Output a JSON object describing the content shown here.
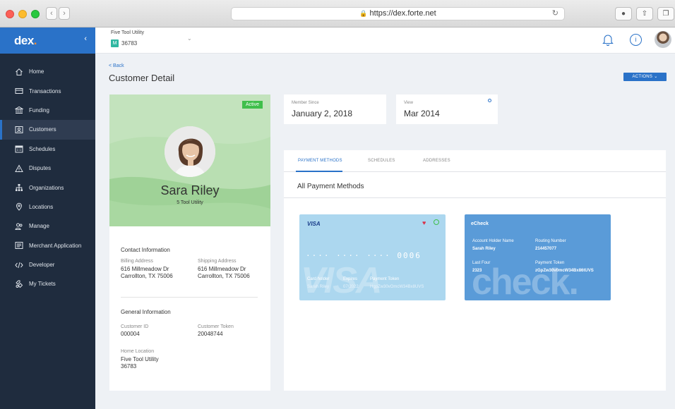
{
  "browser": {
    "url": "https://dex.forte.net"
  },
  "sidebar": {
    "logo": "dex",
    "logo_accent": ".",
    "items": [
      {
        "label": "Home",
        "icon": "home-icon"
      },
      {
        "label": "Transactions",
        "icon": "transactions-icon"
      },
      {
        "label": "Funding",
        "icon": "bank-icon"
      },
      {
        "label": "Customers",
        "icon": "customers-icon",
        "active": true
      },
      {
        "label": "Schedules",
        "icon": "calendar-icon"
      },
      {
        "label": "Disputes",
        "icon": "warning-icon"
      },
      {
        "label": "Organizations",
        "icon": "org-chart-icon"
      },
      {
        "label": "Locations",
        "icon": "location-pin-icon"
      },
      {
        "label": "Manage",
        "icon": "users-icon"
      },
      {
        "label": "Merchant Application",
        "icon": "application-icon"
      },
      {
        "label": "Developer",
        "icon": "code-icon"
      },
      {
        "label": "My Tickets",
        "icon": "ticket-icon"
      }
    ]
  },
  "header": {
    "merchant_name": "Five Tool Utility",
    "merchant_badge": "M",
    "merchant_id": "36783"
  },
  "page": {
    "back": "< Back",
    "title": "Customer Detail",
    "actions": "ACTIONS"
  },
  "customer": {
    "status": "Active",
    "name": "Sara Riley",
    "org": "5 Tool Utility",
    "contact_title": "Contact Information",
    "billing_label": "Billing Address",
    "billing_line1": "616 Millmeadow Dr",
    "billing_line2": "Carrollton, TX 75006",
    "shipping_label": "Shipping Address",
    "shipping_line1": "616 Millmeadow Dr",
    "shipping_line2": "Carrollton, TX 75006",
    "general_title": "General Information",
    "id_label": "Customer ID",
    "id_value": "000004",
    "token_label": "Customer Token",
    "token_value": "20048744",
    "home_label": "Home Location",
    "home_line1": "Five Tool Utility",
    "home_line2": "36783"
  },
  "summary": {
    "member_since_label": "Member Since",
    "member_since_value": "January 2, 2018",
    "view_label": "View",
    "view_value": "Mar 2014"
  },
  "tabs": [
    {
      "label": "PAYMENT METHODS",
      "active": true
    },
    {
      "label": "SCHEDULES"
    },
    {
      "label": "ADDRESSES"
    }
  ],
  "payment_methods": {
    "heading": "All Payment Methods",
    "visa": {
      "brand": "VISA",
      "watermark": "VISA",
      "number": "···· ···· ···· 0006",
      "holder_label": "Card holder",
      "holder_value": "Sarah Riley",
      "expires_label": "Expires",
      "expires_value": "07/2022",
      "token_label": "Payment Token",
      "token_value": "HgpZw30vOmcW34Bx8UVS"
    },
    "echeck": {
      "brand": "eCheck",
      "watermark": "check.",
      "holder_label": "Account Holder Name",
      "holder_value": "Sarah Riley",
      "routing_label": "Routing Number",
      "routing_value": "214457077",
      "last_four_label": "Last Four",
      "last_four_value": "2323",
      "token_label": "Payment Token",
      "token_value": "zGpZw30v0mcW34Bx86tUVS"
    }
  },
  "colors": {
    "accent": "#2a72c8",
    "sidebar": "#1f2c3e",
    "active_badge": "#3fbf4b",
    "hero_green": "#b9dfb2",
    "visa_card": "#acd7ef",
    "echeck_card": "#5a9bd8"
  }
}
